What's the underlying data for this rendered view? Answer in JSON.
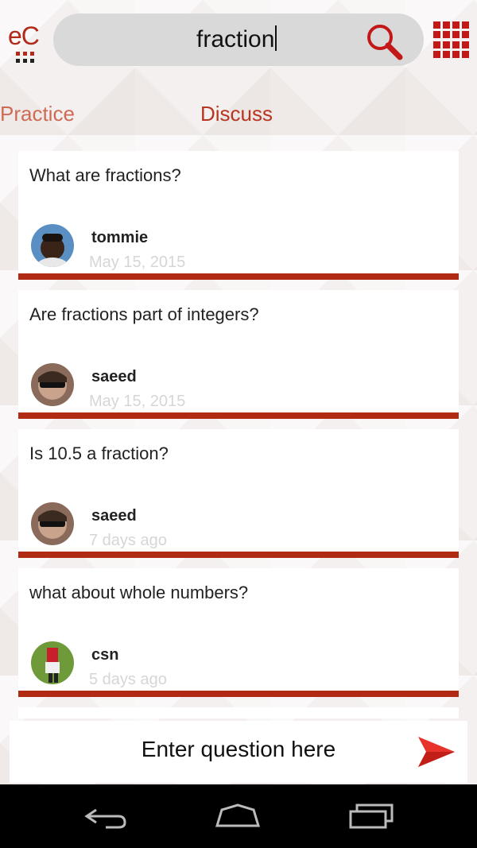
{
  "app": {
    "logo_text": "eC",
    "accent_color": "#b02a14"
  },
  "search": {
    "value": "fraction",
    "icon": "search-icon"
  },
  "menu": {
    "icon": "apps-grid-icon"
  },
  "tabs": [
    {
      "label": "Practice",
      "active": false
    },
    {
      "label": "Discuss",
      "active": true
    }
  ],
  "posts": [
    {
      "question": "What are fractions?",
      "user": "tommie",
      "date": "May 15, 2015"
    },
    {
      "question": "Are fractions part of integers?",
      "user": "saeed",
      "date": "May 15, 2015"
    },
    {
      "question": "Is 10.5 a fraction?",
      "user": "saeed",
      "date": "7 days ago"
    },
    {
      "question": "what about whole numbers?",
      "user": "csn",
      "date": "5 days ago"
    }
  ],
  "ask": {
    "placeholder": "Enter question here",
    "send_icon": "send-icon"
  },
  "navbar": {
    "buttons": [
      "back-icon",
      "home-icon",
      "recents-icon"
    ]
  }
}
